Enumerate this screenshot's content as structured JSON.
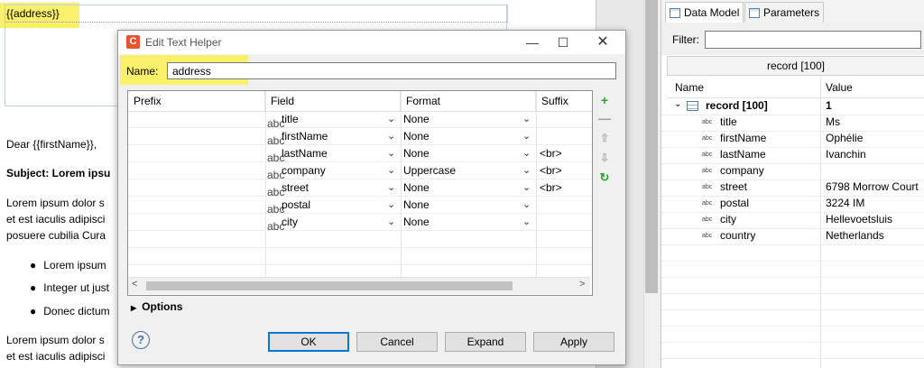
{
  "editor": {
    "address_tag": "{{address}}",
    "greeting": "Dear {{firstName}},",
    "subject": "Subject: Lorem ipsu",
    "para1_l1": "Lorem ipsum dolor s",
    "para1_l2": "et est iaculis adipisci",
    "para1_l3": "posuere cubilia Cura",
    "bullets": [
      "Lorem ipsum",
      "Integer ut just",
      "Donec dictum"
    ],
    "para2_l1": "Lorem ipsum dolor s",
    "para2_l2": "et est iaculis adipisci"
  },
  "dialog": {
    "title": "Edit Text Helper",
    "name_label": "Name:",
    "name_value": "address",
    "columns": [
      "Prefix",
      "Field",
      "Format",
      "Suffix"
    ],
    "rows": [
      {
        "prefix": "",
        "field": "title",
        "format": "None",
        "suffix": ""
      },
      {
        "prefix": "",
        "field": "firstName",
        "format": "None",
        "suffix": ""
      },
      {
        "prefix": "",
        "field": "lastName",
        "format": "None",
        "suffix": "<br>"
      },
      {
        "prefix": "",
        "field": "company",
        "format": "Uppercase",
        "suffix": "<br>"
      },
      {
        "prefix": "",
        "field": "street",
        "format": "None",
        "suffix": "<br>"
      },
      {
        "prefix": "",
        "field": "postal",
        "format": "None",
        "suffix": ""
      },
      {
        "prefix": "",
        "field": "city",
        "format": "None",
        "suffix": ""
      }
    ],
    "options_label": "Options",
    "buttons": {
      "ok": "OK",
      "cancel": "Cancel",
      "expand": "Expand",
      "apply": "Apply"
    },
    "help_glyph": "?"
  },
  "panel": {
    "tabs": [
      "Data Model",
      "Parameters"
    ],
    "filter_label": "Filter:",
    "filter_value": "",
    "record_header": "record [100]",
    "col_name": "Name",
    "col_value": "Value",
    "root_name": "record [100]",
    "root_value": "1",
    "fields": [
      {
        "name": "title",
        "value": "Ms"
      },
      {
        "name": "firstName",
        "value": "Ophélie"
      },
      {
        "name": "lastName",
        "value": "Ivanchin"
      },
      {
        "name": "company",
        "value": ""
      },
      {
        "name": "street",
        "value": "6798 Morrow Court"
      },
      {
        "name": "postal",
        "value": "3224 IM"
      },
      {
        "name": "city",
        "value": "Hellevoetsluis"
      },
      {
        "name": "country",
        "value": "Netherlands"
      }
    ]
  },
  "colors": {
    "highlight": "#fbf06a",
    "accent_blue": "#0078d7",
    "app_logo": "#e8542b"
  },
  "icons": [
    "app-logo-icon",
    "minimize-icon",
    "maximize-icon",
    "close-icon",
    "add-icon",
    "remove-icon",
    "move-up-icon",
    "move-down-icon",
    "refresh-icon",
    "help-icon",
    "data-model-icon",
    "parameters-icon",
    "table-icon"
  ]
}
